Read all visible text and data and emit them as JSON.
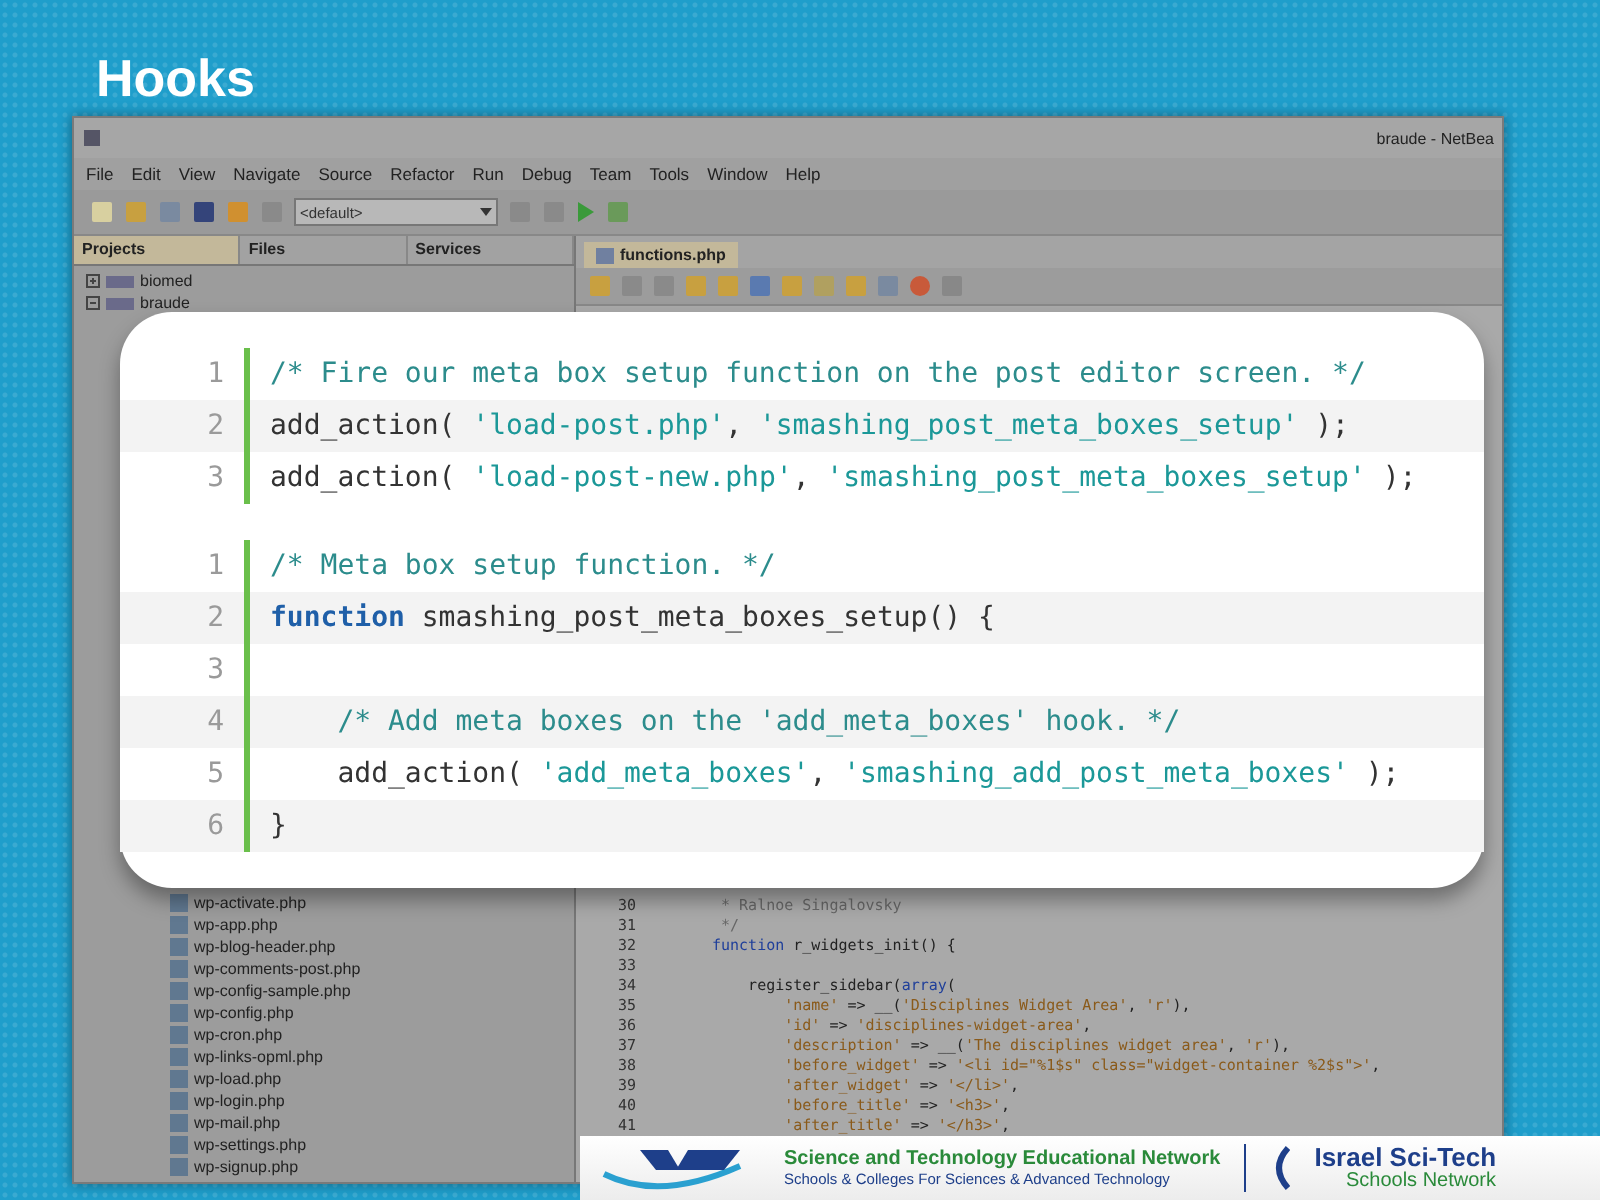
{
  "title": "Hooks",
  "ide": {
    "window_title": "braude - NetBea",
    "menu": [
      "File",
      "Edit",
      "View",
      "Navigate",
      "Source",
      "Refactor",
      "Run",
      "Debug",
      "Team",
      "Tools",
      "Window",
      "Help"
    ],
    "config_select": "<default>",
    "panel_tabs": [
      {
        "label": "Projects",
        "selected": true
      },
      {
        "label": "Files",
        "selected": false
      },
      {
        "label": "Services",
        "selected": false
      }
    ],
    "projects": [
      {
        "label": "biomed",
        "expanded": false
      },
      {
        "label": "braude",
        "expanded": true
      }
    ],
    "files": [
      "wp-activate.php",
      "wp-app.php",
      "wp-blog-header.php",
      "wp-comments-post.php",
      "wp-config-sample.php",
      "wp-config.php",
      "wp-cron.php",
      "wp-links-opml.php",
      "wp-load.php",
      "wp-login.php",
      "wp-mail.php",
      "wp-settings.php",
      "wp-signup.php"
    ],
    "editor_tab": "functions.php",
    "code_lines": [
      {
        "number": "30",
        "segments": [
          {
            "kind": "comment",
            "text": " * Ralnoe Singalovsky"
          }
        ]
      },
      {
        "number": "31",
        "segments": [
          {
            "kind": "comment",
            "text": " */"
          }
        ]
      },
      {
        "number": "32",
        "segments": [
          {
            "kind": "keyword",
            "text": "function"
          },
          {
            "kind": "plain",
            "text": " r_widgets_init() {"
          }
        ]
      },
      {
        "number": "33"
      },
      {
        "number": "34",
        "segments": [
          {
            "kind": "plain",
            "text": "    register_sidebar("
          },
          {
            "kind": "keyword",
            "text": "array"
          },
          {
            "kind": "plain",
            "text": "("
          }
        ]
      },
      {
        "number": "35",
        "segments": [
          {
            "kind": "string",
            "text": "        'name'"
          },
          {
            "kind": "plain",
            "text": " => __("
          },
          {
            "kind": "string",
            "text": "'Disciplines Widget Area'"
          },
          {
            "kind": "plain",
            "text": ", "
          },
          {
            "kind": "string",
            "text": "'r'"
          },
          {
            "kind": "plain",
            "text": "),"
          }
        ]
      },
      {
        "number": "36",
        "segments": [
          {
            "kind": "string",
            "text": "        'id'"
          },
          {
            "kind": "plain",
            "text": " => "
          },
          {
            "kind": "string",
            "text": "'disciplines-widget-area'"
          },
          {
            "kind": "plain",
            "text": ","
          }
        ]
      },
      {
        "number": "37",
        "segments": [
          {
            "kind": "string",
            "text": "        'description'"
          },
          {
            "kind": "plain",
            "text": " => __("
          },
          {
            "kind": "string",
            "text": "'The disciplines widget area'"
          },
          {
            "kind": "plain",
            "text": ", "
          },
          {
            "kind": "string",
            "text": "'r'"
          },
          {
            "kind": "plain",
            "text": "),"
          }
        ]
      },
      {
        "number": "38",
        "segments": [
          {
            "kind": "string",
            "text": "        'before_widget'"
          },
          {
            "kind": "plain",
            "text": " => "
          },
          {
            "kind": "string",
            "text": "'<li id=\"%1$s\" class=\"widget-container %2$s\">'"
          },
          {
            "kind": "plain",
            "text": ","
          }
        ]
      },
      {
        "number": "39",
        "segments": [
          {
            "kind": "string",
            "text": "        'after_widget'"
          },
          {
            "kind": "plain",
            "text": " => "
          },
          {
            "kind": "string",
            "text": "'</li>'"
          },
          {
            "kind": "plain",
            "text": ","
          }
        ]
      },
      {
        "number": "40",
        "segments": [
          {
            "kind": "string",
            "text": "        'before_title'"
          },
          {
            "kind": "plain",
            "text": " => "
          },
          {
            "kind": "string",
            "text": "'<h3>'"
          },
          {
            "kind": "plain",
            "text": ","
          }
        ]
      },
      {
        "number": "41",
        "segments": [
          {
            "kind": "string",
            "text": "        'after_title'"
          },
          {
            "kind": "plain",
            "text": " => "
          },
          {
            "kind": "string",
            "text": "'</h3>'"
          },
          {
            "kind": "plain",
            "text": ","
          }
        ]
      }
    ]
  },
  "snippets": [
    {
      "lines": [
        {
          "number": "1",
          "segments": [
            {
              "kind": "comment",
              "text": "/* Fire our meta box setup function on the post editor screen. */"
            }
          ]
        },
        {
          "number": "2",
          "segments": [
            {
              "kind": "plain",
              "text": "add_action( "
            },
            {
              "kind": "string",
              "text": "'load-post.php'"
            },
            {
              "kind": "plain",
              "text": ", "
            },
            {
              "kind": "string",
              "text": "'smashing_post_meta_boxes_setup'"
            },
            {
              "kind": "plain",
              "text": " );"
            }
          ]
        },
        {
          "number": "3",
          "segments": [
            {
              "kind": "plain",
              "text": "add_action( "
            },
            {
              "kind": "string",
              "text": "'load-post-new.php'"
            },
            {
              "kind": "plain",
              "text": ", "
            },
            {
              "kind": "string",
              "text": "'smashing_post_meta_boxes_setup'"
            },
            {
              "kind": "plain",
              "text": " );"
            }
          ]
        }
      ]
    },
    {
      "lines": [
        {
          "number": "1",
          "segments": [
            {
              "kind": "comment",
              "text": "/* Meta box setup function. */"
            }
          ]
        },
        {
          "number": "2",
          "segments": [
            {
              "kind": "keyword",
              "text": "function"
            },
            {
              "kind": "plain",
              "text": " smashing_post_meta_boxes_setup() {"
            }
          ]
        },
        {
          "number": "3"
        },
        {
          "number": "4",
          "segments": [
            {
              "kind": "comment",
              "text": "    /* Add meta boxes on the 'add_meta_boxes' hook. */"
            }
          ]
        },
        {
          "number": "5",
          "segments": [
            {
              "kind": "plain",
              "text": "    add_action( "
            },
            {
              "kind": "string",
              "text": "'add_meta_boxes'"
            },
            {
              "kind": "plain",
              "text": ", "
            },
            {
              "kind": "string",
              "text": "'smashing_add_post_meta_boxes'"
            },
            {
              "kind": "plain",
              "text": " );"
            }
          ]
        },
        {
          "number": "6",
          "segments": [
            {
              "kind": "plain",
              "text": "}"
            }
          ]
        }
      ]
    }
  ],
  "footer": {
    "network_line": "Science and Technology Educational Network",
    "schools_line": "Schools & Colleges For Sciences & Advanced Technology",
    "brand_name": "Israel Sci-Tech",
    "brand_sub": "Schools Network"
  }
}
